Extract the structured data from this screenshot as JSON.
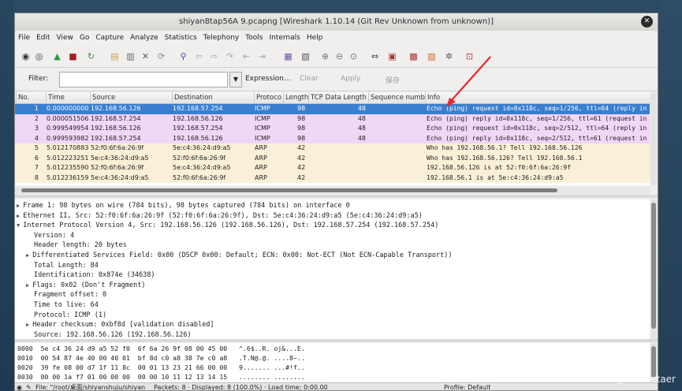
{
  "window": {
    "title": "shiyan8tap56A 9.pcapng  [Wireshark 1.10.14  (Git Rev Unknown from unknown)]"
  },
  "menu": [
    "File",
    "Edit",
    "View",
    "Go",
    "Capture",
    "Analyze",
    "Statistics",
    "Telephony",
    "Tools",
    "Internals",
    "Help"
  ],
  "toolbar_icons": [
    "interfaces-icon",
    "options-icon",
    "start-capture-icon",
    "stop-capture-icon",
    "restart-capture-icon",
    "open-file-icon",
    "save-file-icon",
    "close-file-icon",
    "reload-icon",
    "find-packet-icon",
    "go-back-icon",
    "go-forward-icon",
    "go-to-packet-icon",
    "first-packet-icon",
    "last-packet-icon",
    "colorize-icon",
    "auto-scroll-icon",
    "zoom-in-icon",
    "zoom-out-icon",
    "normal-size-icon",
    "resize-columns-icon",
    "capture-filters-icon",
    "display-filters-icon",
    "coloring-rules-icon",
    "preferences-icon",
    "help-icon"
  ],
  "filter": {
    "label": "Filter:",
    "value": "",
    "expression": "Expression...",
    "clear": "Clear",
    "apply": "Apply",
    "save": "保存"
  },
  "columns": [
    "No.",
    "Time",
    "Source",
    "Destination",
    "Protoco",
    "Length",
    "TCP Data Length",
    "Sequence numbe",
    "Info"
  ],
  "packets": [
    {
      "no": "1",
      "time": "0.000000000",
      "src": "192.168.56.126",
      "dst": "192.168.57.254",
      "proto": "ICMP",
      "len": "98",
      "tcplen": "48",
      "seq": "",
      "info": "Echo (ping) request  id=0x118c, seq=1/256, ttl=64 (reply in 2)"
    },
    {
      "no": "2",
      "time": "0.000051506",
      "src": "192.168.57.254",
      "dst": "192.168.56.126",
      "proto": "ICMP",
      "len": "98",
      "tcplen": "48",
      "seq": "",
      "info": "Echo (ping) reply    id=0x118c, seq=1/256, ttl=61 (request in 1"
    },
    {
      "no": "3",
      "time": "0.999549954",
      "src": "192.168.56.126",
      "dst": "192.168.57.254",
      "proto": "ICMP",
      "len": "98",
      "tcplen": "48",
      "seq": "",
      "info": "Echo (ping) request  id=0x118c, seq=2/512, ttl=64 (reply in 4)"
    },
    {
      "no": "4",
      "time": "0.999593982",
      "src": "192.168.57.254",
      "dst": "192.168.56.126",
      "proto": "ICMP",
      "len": "98",
      "tcplen": "48",
      "seq": "",
      "info": "Echo (ping) reply    id=0x118c, seq=2/512, ttl=61 (request in 3"
    },
    {
      "no": "5",
      "time": "5.012170883",
      "src": "52:f0:6f:6a:26:9f",
      "dst": "5e:c4:36:24:d9:a5",
      "proto": "ARP",
      "len": "42",
      "tcplen": "",
      "seq": "",
      "info": "Who has 192.168.56.1?  Tell 192.168.56.126"
    },
    {
      "no": "6",
      "time": "5.012223251",
      "src": "5e:c4:36:24:d9:a5",
      "dst": "52:f0:6f:6a:26:9f",
      "proto": "ARP",
      "len": "42",
      "tcplen": "",
      "seq": "",
      "info": "Who has 192.168.56.126?  Tell 192.168.56.1"
    },
    {
      "no": "7",
      "time": "5.012235590",
      "src": "52:f0:6f:6a:26:9f",
      "dst": "5e:c4:36:24:d9:a5",
      "proto": "ARP",
      "len": "42",
      "tcplen": "",
      "seq": "",
      "info": "192.168.56.126 is at 52:f0:6f:6a:26:9f"
    },
    {
      "no": "8",
      "time": "5.012236159",
      "src": "5e:c4:36:24:d9:a5",
      "dst": "52:f0:6f:6a:26:9f",
      "proto": "ARP",
      "len": "42",
      "tcplen": "",
      "seq": "",
      "info": "192.168.56.1 is at 5e:c4:36:24:d9:a5"
    }
  ],
  "row_colors": {
    "selected": "#3a7ecf",
    "icmp": "#f0d6f7",
    "arp": "#faf0d7"
  },
  "details": [
    {
      "indent": 0,
      "arrow": "collapsed",
      "text": "Frame 1: 98 bytes on wire (784 bits), 98 bytes captured (784 bits) on interface 0"
    },
    {
      "indent": 0,
      "arrow": "collapsed",
      "text": "Ethernet II, Src: 52:f0:6f:6a:26:9f (52:f0:6f:6a:26:9f), Dst: 5e:c4:36:24:d9:a5 (5e:c4:36:24:d9:a5)"
    },
    {
      "indent": 0,
      "arrow": "expanded",
      "text": "Internet Protocol Version 4, Src: 192.168.56.126 (192.168.56.126), Dst: 192.168.57.254 (192.168.57.254)"
    },
    {
      "indent": 1,
      "arrow": "none",
      "text": "Version: 4"
    },
    {
      "indent": 1,
      "arrow": "none",
      "text": "Header length: 20 bytes"
    },
    {
      "indent": 1,
      "arrow": "collapsed",
      "text": "Differentiated Services Field: 0x00 (DSCP 0x00: Default; ECN: 0x00: Not-ECT (Not ECN-Capable Transport))"
    },
    {
      "indent": 1,
      "arrow": "none",
      "text": "Total Length: 84"
    },
    {
      "indent": 1,
      "arrow": "none",
      "text": "Identification: 0x874e (34638)"
    },
    {
      "indent": 1,
      "arrow": "collapsed",
      "text": "Flags: 0x02 (Don't Fragment)"
    },
    {
      "indent": 1,
      "arrow": "none",
      "text": "Fragment offset: 0"
    },
    {
      "indent": 1,
      "arrow": "none",
      "text": "Time to live: 64"
    },
    {
      "indent": 1,
      "arrow": "none",
      "text": "Protocol: ICMP (1)"
    },
    {
      "indent": 1,
      "arrow": "collapsed",
      "text": "Header checksum: 0xbf8d [validation disabled]"
    },
    {
      "indent": 1,
      "arrow": "none",
      "text": "Source: 192.168.56.126 (192.168.56.126)"
    }
  ],
  "hex": [
    "0000  5e c4 36 24 d9 a5 52 f0  6f 6a 26 9f 08 00 45 00   ^.6$..R. oj&...E.",
    "0010  00 54 87 4e 40 00 40 01  bf 8d c0 a8 38 7e c0 a8   .T.N@.@. ....8~..",
    "0020  39 fe 08 00 d7 1f 11 8c  00 01 13 23 21 66 00 00   9....... ...#!f..",
    "0030  00 00 1a f7 01 00 00 00  00 00 10 11 12 13 14 15   ........ ........"
  ],
  "status": {
    "file": "File: \"/root/桌面/shiyanshuju/shiyan···",
    "packets": "Packets: 8 · Displayed: 8 (100.0%) · Load time: 0:00.000",
    "profile": "Profile: Default"
  },
  "watermark": "CSDN @wendetaer"
}
